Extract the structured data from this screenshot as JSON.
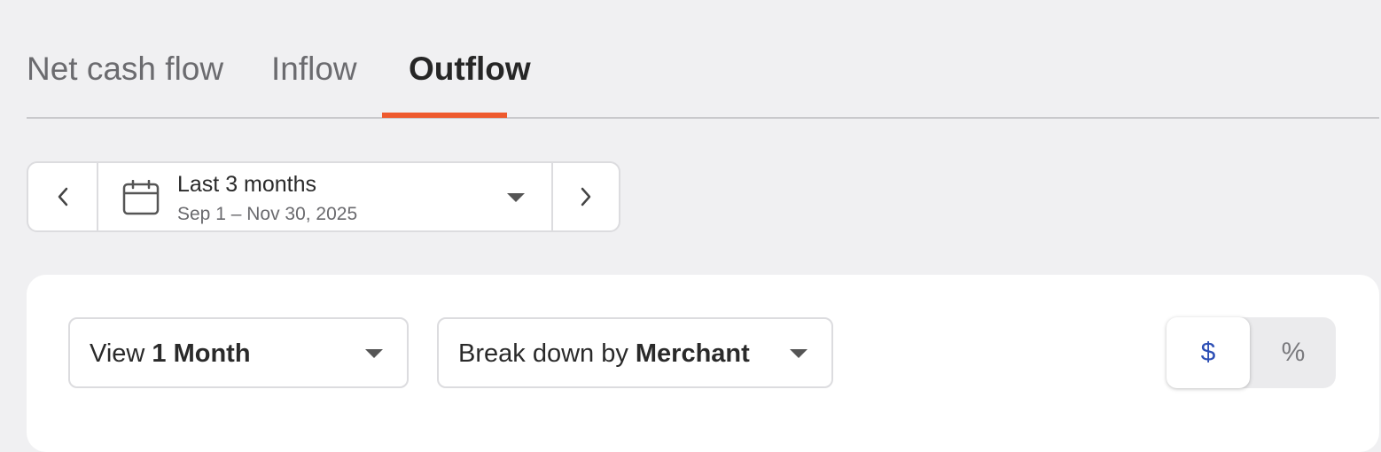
{
  "tabs": [
    {
      "label": "Net cash flow",
      "active": false
    },
    {
      "label": "Inflow",
      "active": false
    },
    {
      "label": "Outflow",
      "active": true
    }
  ],
  "accent_color": "#ee5a2e",
  "date_range": {
    "title": "Last 3 months",
    "subtitle": "Sep 1 – Nov 30, 2025",
    "prev_icon": "chevron-left-icon",
    "next_icon": "chevron-right-icon",
    "icon": "calendar-icon"
  },
  "controls": {
    "view": {
      "prefix": "View",
      "value": "1 Month"
    },
    "breakdown": {
      "prefix": "Break down by",
      "value": "Merchant"
    },
    "unit_toggle": {
      "options": [
        "$",
        "%"
      ],
      "selected": "$",
      "selected_color": "#2d4fb5"
    }
  }
}
